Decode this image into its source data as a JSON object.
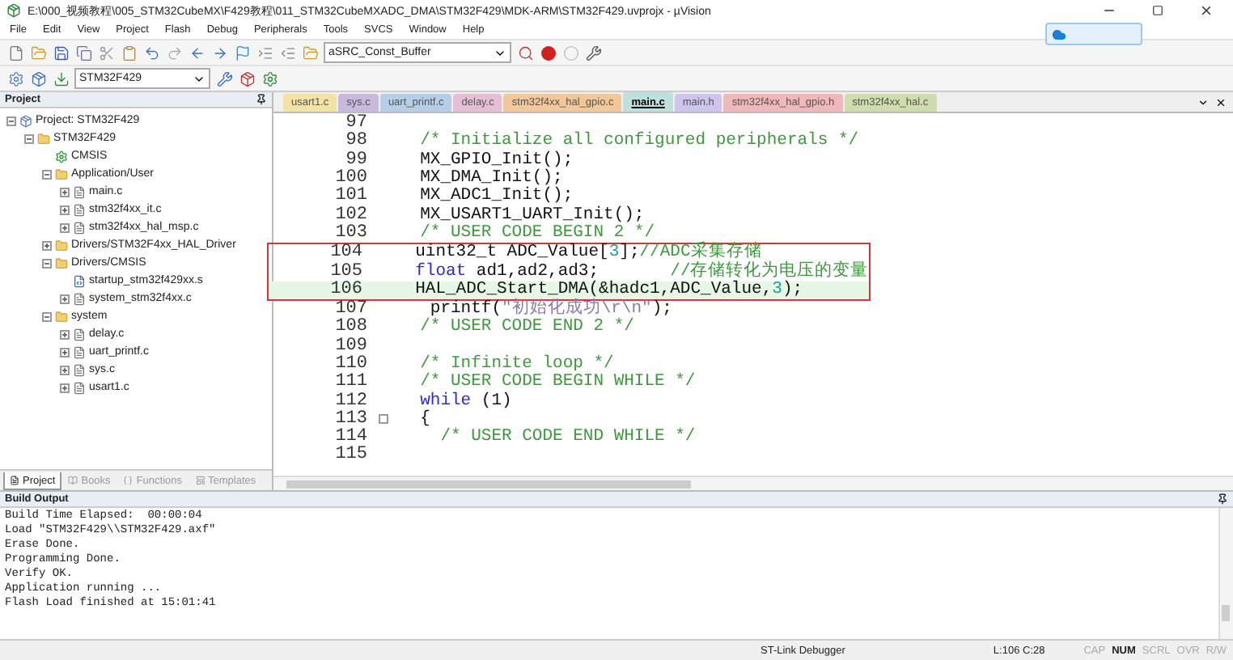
{
  "window": {
    "title": "E:\\000_视频教程\\005_STM32CubeMX\\F429教程\\011_STM32CubeMXADC_DMA\\STM32F429\\MDK-ARM\\STM32F429.uvprojx - µVision"
  },
  "menu": [
    "File",
    "Edit",
    "View",
    "Project",
    "Flash",
    "Debug",
    "Peripherals",
    "Tools",
    "SVCS",
    "Window",
    "Help"
  ],
  "toolbar": {
    "find_combo": "aSRC_Const_Buffer",
    "target_combo": "STM32F429"
  },
  "project_panel": {
    "title": "Project",
    "tree": [
      {
        "label": "Project: STM32F429",
        "kind": "project",
        "expanded": true,
        "children": [
          {
            "label": "STM32F429",
            "kind": "target",
            "expanded": true,
            "children": [
              {
                "label": "CMSIS",
                "kind": "component"
              },
              {
                "label": "Application/User",
                "kind": "folder",
                "expanded": true,
                "children": [
                  {
                    "label": "main.c",
                    "kind": "file",
                    "expanded": false
                  },
                  {
                    "label": "stm32f4xx_it.c",
                    "kind": "file",
                    "expanded": false
                  },
                  {
                    "label": "stm32f4xx_hal_msp.c",
                    "kind": "file",
                    "expanded": false
                  }
                ]
              },
              {
                "label": "Drivers/STM32F4xx_HAL_Driver",
                "kind": "folder",
                "expanded": false
              },
              {
                "label": "Drivers/CMSIS",
                "kind": "folder",
                "expanded": true,
                "children": [
                  {
                    "label": "startup_stm32f429xx.s",
                    "kind": "source"
                  },
                  {
                    "label": "system_stm32f4xx.c",
                    "kind": "file",
                    "expanded": false
                  }
                ]
              },
              {
                "label": "system",
                "kind": "folder",
                "expanded": true,
                "children": [
                  {
                    "label": "delay.c",
                    "kind": "file",
                    "expanded": false
                  },
                  {
                    "label": "uart_printf.c",
                    "kind": "file",
                    "expanded": false
                  },
                  {
                    "label": "sys.c",
                    "kind": "file",
                    "expanded": false
                  },
                  {
                    "label": "usart1.c",
                    "kind": "file",
                    "expanded": false
                  }
                ]
              }
            ]
          }
        ]
      }
    ],
    "tabs": [
      {
        "label": "Project",
        "selected": true
      },
      {
        "label": "Books",
        "selected": false
      },
      {
        "label": "Functions",
        "selected": false
      },
      {
        "label": "Templates",
        "selected": false
      }
    ]
  },
  "editor": {
    "tabs": [
      {
        "label": "usart1.c",
        "selected": false,
        "color": "#f3e3a6"
      },
      {
        "label": "sys.c",
        "selected": false,
        "color": "#c9b9de"
      },
      {
        "label": "uart_printf.c",
        "selected": false,
        "color": "#b6cfe6"
      },
      {
        "label": "delay.c",
        "selected": false,
        "color": "#e6bfd6"
      },
      {
        "label": "stm32f4xx_hal_gpio.c",
        "selected": false,
        "color": "#f2c89a"
      },
      {
        "label": "main.c",
        "selected": true,
        "color": "#bfe0dc"
      },
      {
        "label": "main.h",
        "selected": false,
        "color": "#cfc4ee"
      },
      {
        "label": "stm32f4xx_hal_gpio.h",
        "selected": false,
        "color": "#f0b8b8"
      },
      {
        "label": "stm32f4xx_hal.c",
        "selected": false,
        "color": "#cfdcae"
      }
    ],
    "lines": [
      {
        "number": "97",
        "current": false,
        "boxed": false,
        "fold": false
      },
      {
        "number": "98",
        "current": false,
        "boxed": false,
        "fold": false,
        "segments": [
          {
            "kind": "comment",
            "text": "  /* Initialize all configured peripherals */"
          }
        ]
      },
      {
        "number": "99",
        "current": false,
        "boxed": false,
        "fold": false,
        "segments": [
          {
            "kind": "plain",
            "text": "  MX_GPIO_Init();"
          }
        ]
      },
      {
        "number": "100",
        "current": false,
        "boxed": false,
        "fold": false,
        "segments": [
          {
            "kind": "plain",
            "text": "  MX_DMA_Init();"
          }
        ]
      },
      {
        "number": "101",
        "current": false,
        "boxed": false,
        "fold": false,
        "segments": [
          {
            "kind": "plain",
            "text": "  MX_ADC1_Init();"
          }
        ]
      },
      {
        "number": "102",
        "current": false,
        "boxed": false,
        "fold": false,
        "segments": [
          {
            "kind": "plain",
            "text": "  MX_USART1_UART_Init();"
          }
        ]
      },
      {
        "number": "103",
        "current": false,
        "boxed": false,
        "fold": false,
        "segments": [
          {
            "kind": "comment",
            "text": "  /* USER CODE BEGIN 2 */"
          }
        ]
      },
      {
        "number": "104",
        "current": false,
        "boxed": true,
        "fold": false,
        "segments": [
          {
            "kind": "plain",
            "text": "  uint32_t ADC_Value["
          },
          {
            "kind": "number",
            "text": "3"
          },
          {
            "kind": "plain",
            "text": "];"
          },
          {
            "kind": "comment",
            "text": "//ADC采集存储"
          }
        ]
      },
      {
        "number": "105",
        "current": false,
        "boxed": true,
        "fold": false,
        "segments": [
          {
            "kind": "keyword",
            "text": "  float"
          },
          {
            "kind": "plain",
            "text": " ad1,ad2,ad3;       "
          },
          {
            "kind": "comment",
            "text": "//存储转化为电压的变量"
          }
        ]
      },
      {
        "number": "106",
        "current": true,
        "boxed": true,
        "fold": false,
        "segments": [
          {
            "kind": "plain",
            "text": "  HAL_ADC_Start_DMA(&hadc1,ADC_Value,"
          },
          {
            "kind": "number",
            "text": "3"
          },
          {
            "kind": "plain",
            "text": ");"
          }
        ]
      },
      {
        "number": "107",
        "current": false,
        "boxed": false,
        "fold": false,
        "segments": [
          {
            "kind": "plain",
            "text": "   printf("
          },
          {
            "kind": "string",
            "text": "\"初始化成功\\r\\n\""
          },
          {
            "kind": "plain",
            "text": ");"
          }
        ]
      },
      {
        "number": "108",
        "current": false,
        "boxed": false,
        "fold": false,
        "segments": [
          {
            "kind": "comment",
            "text": "  /* USER CODE END 2 */"
          }
        ]
      },
      {
        "number": "109",
        "current": false,
        "boxed": false,
        "fold": false
      },
      {
        "number": "110",
        "current": false,
        "boxed": false,
        "fold": false,
        "segments": [
          {
            "kind": "comment",
            "text": "  /* Infinite loop */"
          }
        ]
      },
      {
        "number": "111",
        "current": false,
        "boxed": false,
        "fold": false,
        "segments": [
          {
            "kind": "comment",
            "text": "  /* USER CODE BEGIN WHILE */"
          }
        ]
      },
      {
        "number": "112",
        "current": false,
        "boxed": false,
        "fold": false,
        "segments": [
          {
            "kind": "keyword",
            "text": "  while"
          },
          {
            "kind": "plain",
            "text": " (1)"
          }
        ]
      },
      {
        "number": "113",
        "current": false,
        "boxed": false,
        "fold": true,
        "segments": [
          {
            "kind": "plain",
            "text": "  {"
          }
        ]
      },
      {
        "number": "114",
        "current": false,
        "boxed": false,
        "fold": false,
        "segments": [
          {
            "kind": "comment",
            "text": "    /* USER CODE END WHILE */"
          }
        ]
      },
      {
        "number": "115",
        "current": false,
        "boxed": false,
        "fold": false
      }
    ]
  },
  "build_output": {
    "title": "Build Output",
    "lines": [
      "Build Time Elapsed:  00:00:04",
      "Load \"STM32F429\\\\STM32F429.axf\"",
      "Erase Done.",
      "Programming Done.",
      "Verify OK.",
      "Application running ...",
      "Flash Load finished at 15:01:41"
    ]
  },
  "status_bar": {
    "debugger": "ST-Link Debugger",
    "position": "L:106 C:28",
    "indicators": [
      {
        "label": "CAP",
        "on": false
      },
      {
        "label": "NUM",
        "on": true
      },
      {
        "label": "SCRL",
        "on": false
      },
      {
        "label": "OVR",
        "on": false
      },
      {
        "label": "R/W",
        "on": false
      }
    ]
  }
}
